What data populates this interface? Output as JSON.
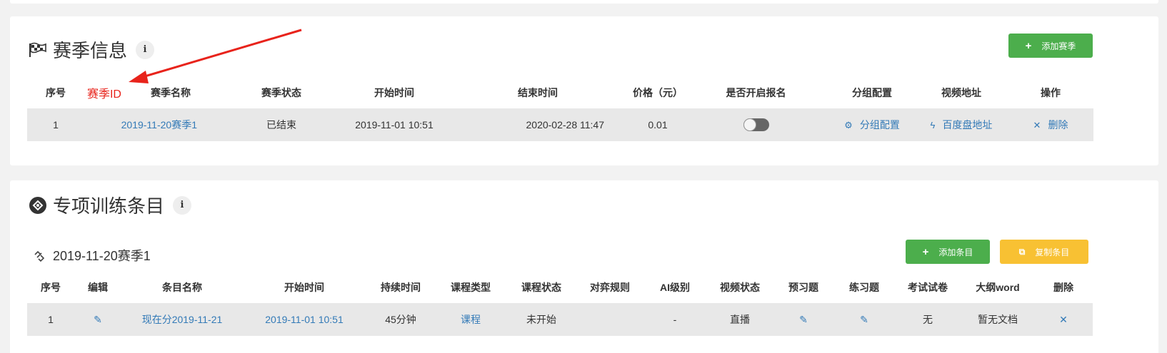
{
  "season": {
    "title": "赛季信息",
    "info": "i",
    "add_button": "添加赛季",
    "columns": [
      "序号",
      "赛季ID",
      "赛季名称",
      "赛季状态",
      "开始时间",
      "结束时间",
      "价格（元）",
      "是否开启报名",
      "分组配置",
      "视频地址",
      "操作"
    ],
    "row": {
      "index": "1",
      "name": "2019-11-20赛季1",
      "status": "已结束",
      "start": "2019-11-01 10:51",
      "end": "2020-02-28 11:47",
      "price": "0.01",
      "group_config": "分组配置",
      "video": "百度盘地址",
      "delete": "删除"
    }
  },
  "training": {
    "title": "专项训练条目",
    "info": "i",
    "season_name": "2019-11-20赛季1",
    "add_button": "添加条目",
    "copy_button": "复制条目",
    "columns": [
      "序号",
      "编辑",
      "条目名称",
      "开始时间",
      "持续时间",
      "课程类型",
      "课程状态",
      "对弈规则",
      "AI级别",
      "视频状态",
      "预习题",
      "练习题",
      "考试试卷",
      "大纲word",
      "删除"
    ],
    "row": {
      "index": "1",
      "name": "现在分2019-11-21",
      "start": "2019-11-01 10:51",
      "duration": "45分钟",
      "course_type": "课程",
      "course_status": "未开始",
      "rule": "",
      "ai_level": "-",
      "video_status": "直播",
      "exam": "无",
      "outline": "暂无文档"
    }
  },
  "colors": {
    "green": "#4cae4c",
    "yellow": "#f8c133",
    "link": "#337ab7",
    "red": "#e8231b"
  }
}
